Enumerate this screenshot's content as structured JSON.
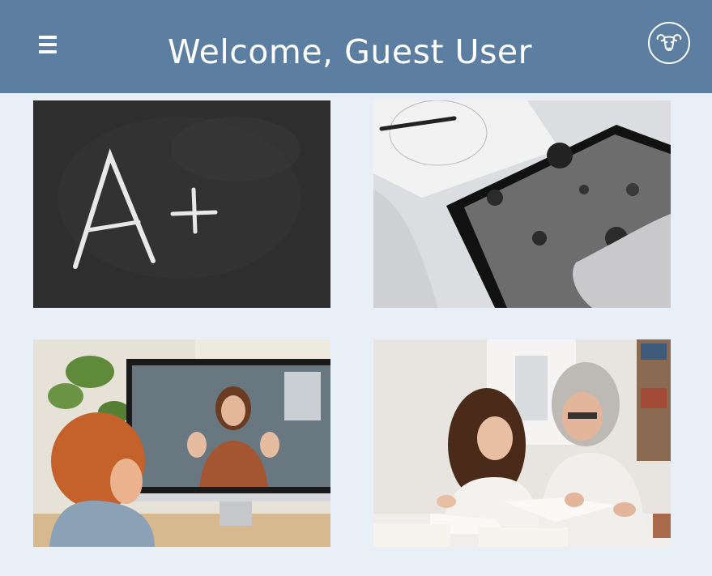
{
  "header": {
    "title": "Welcome, Guest User",
    "menu_icon": "hamburger-menu-icon",
    "logo_icon": "ram-head-logo-icon"
  },
  "colors": {
    "header_bg": "#5b7ea1",
    "page_bg": "#e9eff7",
    "title_text": "#ffffff"
  },
  "tiles": [
    {
      "image": "chalkboard-a-plus"
    },
    {
      "image": "tablet-moon-surface"
    },
    {
      "image": "video-call-lesson"
    },
    {
      "image": "grandmother-tutoring-girl"
    }
  ]
}
